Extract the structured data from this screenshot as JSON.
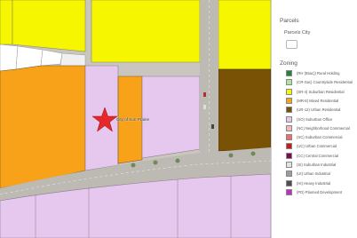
{
  "map": {
    "place_label": "City of Sun Prairie",
    "marker_icon": "star-marker-icon",
    "marker_color": "#e8272b",
    "road_color": "#bdbab3",
    "colors": {
      "suburban_residential": "#f6f600",
      "mixed_residential": "#f8a21a",
      "urban_residential": "#7a5206",
      "suburban_office": "#e6c8ef",
      "white_lots": "#ffffff"
    }
  },
  "legend": {
    "title": "Parcels",
    "parcel_layer": "Parcels City",
    "zoning_title": "Zoning",
    "items": [
      {
        "label": "(RH (55ac)) Rural Holding",
        "color": "#2a7f3a"
      },
      {
        "label": "(CR-Sac) Countryside Residential",
        "color": "#aee59a"
      },
      {
        "label": "(SR-4) Suburban Residential",
        "color": "#f6f600"
      },
      {
        "label": "(MR-8) Mixed Residential",
        "color": "#f8a21a"
      },
      {
        "label": "(UR-12) Urban Residential",
        "color": "#7a5206"
      },
      {
        "label": "(SO) Suburban Office",
        "color": "#e6c8ef"
      },
      {
        "label": "(NC) Neighborhood Commercial",
        "color": "#f4b8b8"
      },
      {
        "label": "(SC) Suburban Commercial",
        "color": "#ee6e6e"
      },
      {
        "label": "(UC) Urban Commercial",
        "color": "#cc1818"
      },
      {
        "label": "(CC) Central Commercial",
        "color": "#7c0a4e"
      },
      {
        "label": "(SI) Suburban Industrial",
        "color": "#e3e3e3"
      },
      {
        "label": "(UI) Urban Industrial",
        "color": "#9d9d9d"
      },
      {
        "label": "(HI) Heavy Industrial",
        "color": "#4e4e4e"
      },
      {
        "label": "(PD) Planned Development",
        "color": "#c02cc6"
      }
    ]
  }
}
